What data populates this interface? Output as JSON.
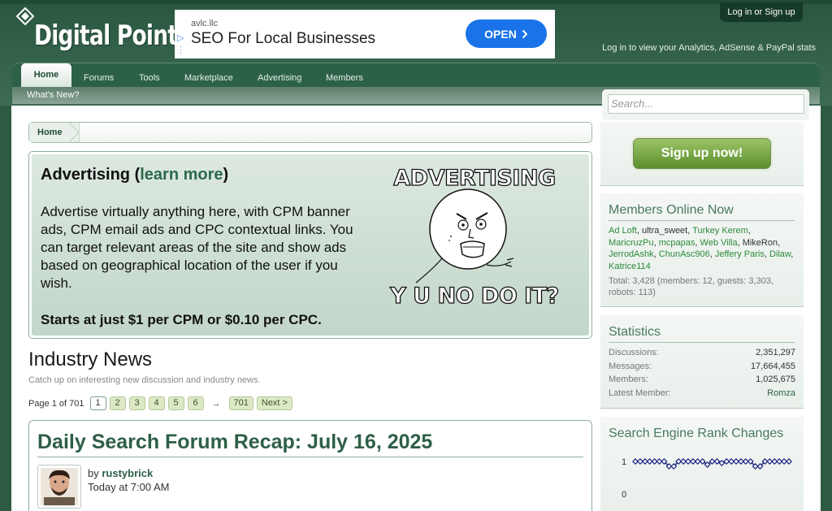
{
  "header": {
    "logo": "Digital Point",
    "login_label": "Log in or Sign up",
    "message": "Log in to view your Analytics, AdSense & PayPal stats"
  },
  "banner_ad": {
    "domain": "avlc.llc",
    "title": "SEO For Local Businesses",
    "button": "OPEN"
  },
  "nav": {
    "tabs": [
      "Home",
      "Forums",
      "Tools",
      "Marketplace",
      "Advertising",
      "Members"
    ],
    "sub_link": "What's New?"
  },
  "search": {
    "placeholder": "Search..."
  },
  "breadcrumb": {
    "home": "Home"
  },
  "advertising": {
    "title_prefix": "Advertising (",
    "title_link": "learn more",
    "title_suffix": ")",
    "body": "Advertise virtually anything here, with CPM banner ads, CPM email ads and CPC contextual links. You can target relevant areas of the site and show ads based on geographical location of the user if you wish.",
    "price": "Starts at just $1 per CPM or $0.10 per CPC.",
    "meme_top": "ADVERTISING",
    "meme_bottom": "Y U NO DO IT?"
  },
  "news": {
    "title": "Industry News",
    "description": "Catch up on interesting new discussion and industry news.",
    "pager_label": "Page 1 of 701",
    "pages": [
      "1",
      "2",
      "3",
      "4",
      "5",
      "6"
    ],
    "arrow": "→",
    "last_page": "701",
    "next": "Next >"
  },
  "article": {
    "title": "Daily Search Forum Recap: July 16, 2025",
    "by_prefix": "by ",
    "author": "rustybrick",
    "time": "Today at 7:00 AM"
  },
  "sidebar": {
    "signup": "Sign up now!",
    "members_online": {
      "title": "Members Online Now",
      "members": [
        {
          "name": "Ad Loft",
          "link": true
        },
        {
          "name": "ultra_sweet",
          "link": false
        },
        {
          "name": "Turkey Kerem",
          "link": true
        },
        {
          "name": "MaricruzPu",
          "link": true
        },
        {
          "name": "mcpapas",
          "link": true
        },
        {
          "name": "Web Villa",
          "link": true
        },
        {
          "name": "MikeRon",
          "link": false
        },
        {
          "name": "JerrodAshk",
          "link": true
        },
        {
          "name": "ChunAsc906",
          "link": true
        },
        {
          "name": "Jeffery Paris",
          "link": true
        },
        {
          "name": "Dilaw",
          "link": true
        },
        {
          "name": "Katrice114",
          "link": true
        }
      ],
      "total": "Total: 3,428 (members: 12, guests: 3,303, robots: 113)"
    },
    "statistics": {
      "title": "Statistics",
      "rows": [
        {
          "label": "Discussions:",
          "value": "2,351,297"
        },
        {
          "label": "Messages:",
          "value": "17,664,455"
        },
        {
          "label": "Members:",
          "value": "1,025,675"
        },
        {
          "label": "Latest Member:",
          "value": "Romza"
        }
      ]
    },
    "serp": {
      "title": "Search Engine Rank Changes",
      "y_labels": [
        "1",
        "0"
      ]
    }
  },
  "chart_data": {
    "type": "line",
    "series": [
      {
        "values": [
          1,
          1,
          1,
          1,
          1,
          1,
          1,
          0.85,
          0.85,
          1,
          1,
          1,
          1,
          1,
          1,
          0.9,
          1,
          1,
          0.95,
          1,
          1,
          1,
          1,
          1,
          1,
          0.85,
          0.85,
          1,
          1,
          1,
          1,
          1,
          1
        ]
      }
    ],
    "ylim": [
      0,
      1
    ]
  },
  "colors": {
    "accent": "#2e5f47",
    "nav": "#2c6147",
    "link_green": "#2c8a3a"
  }
}
